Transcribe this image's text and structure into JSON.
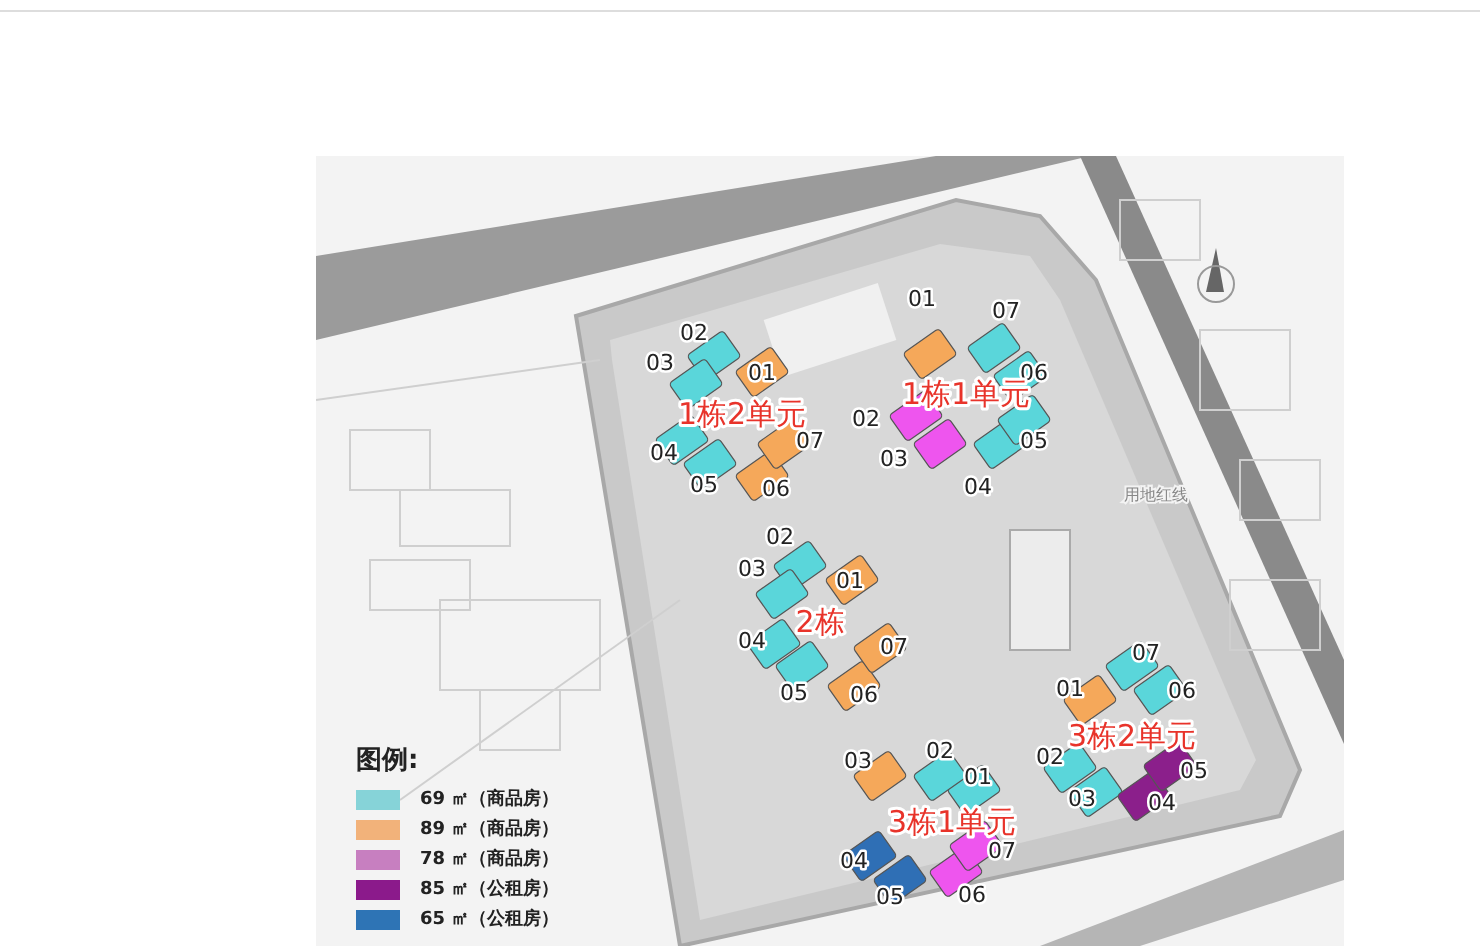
{
  "site_plan": {
    "buildings": [
      {
        "label": "1栋2单元",
        "units": [
          {
            "number": "01",
            "color": "#f5a85a"
          },
          {
            "number": "02",
            "color": "#5ad6da"
          },
          {
            "number": "03",
            "color": "#5ad6da"
          },
          {
            "number": "04",
            "color": "#5ad6da"
          },
          {
            "number": "05",
            "color": "#5ad6da"
          },
          {
            "number": "06",
            "color": "#f5a85a"
          },
          {
            "number": "07",
            "color": "#f5a85a"
          }
        ]
      },
      {
        "label": "1栋1单元",
        "units": [
          {
            "number": "01",
            "color": "#f5a85a"
          },
          {
            "number": "02",
            "color": "#ee55ee"
          },
          {
            "number": "03",
            "color": "#ee55ee"
          },
          {
            "number": "04",
            "color": "#5ad6da"
          },
          {
            "number": "05",
            "color": "#5ad6da"
          },
          {
            "number": "06",
            "color": "#5ad6da"
          },
          {
            "number": "07",
            "color": "#5ad6da"
          }
        ]
      },
      {
        "label": "2栋",
        "units": [
          {
            "number": "01",
            "color": "#f5a85a"
          },
          {
            "number": "02",
            "color": "#5ad6da"
          },
          {
            "number": "03",
            "color": "#5ad6da"
          },
          {
            "number": "04",
            "color": "#5ad6da"
          },
          {
            "number": "05",
            "color": "#5ad6da"
          },
          {
            "number": "06",
            "color": "#f5a85a"
          },
          {
            "number": "07",
            "color": "#f5a85a"
          }
        ]
      },
      {
        "label": "3栋2单元",
        "units": [
          {
            "number": "01",
            "color": "#f5a85a"
          },
          {
            "number": "02",
            "color": "#5ad6da"
          },
          {
            "number": "03",
            "color": "#5ad6da"
          },
          {
            "number": "04",
            "color": "#8b1f8b"
          },
          {
            "number": "05",
            "color": "#8b1f8b"
          },
          {
            "number": "06",
            "color": "#5ad6da"
          },
          {
            "number": "07",
            "color": "#5ad6da"
          }
        ]
      },
      {
        "label": "3栋1单元",
        "units": [
          {
            "number": "01",
            "color": "#5ad6da"
          },
          {
            "number": "02",
            "color": "#5ad6da"
          },
          {
            "number": "03",
            "color": "#f5a85a"
          },
          {
            "number": "04",
            "color": "#2f6fb5"
          },
          {
            "number": "05",
            "color": "#2f6fb5"
          },
          {
            "number": "06",
            "color": "#ee55ee"
          },
          {
            "number": "07",
            "color": "#ee55ee"
          }
        ]
      }
    ],
    "map_note": "用地红线",
    "legend": {
      "title": "图例:",
      "items": [
        {
          "text": "69 ㎡（商品房）",
          "color": "#86d3d8"
        },
        {
          "text": "89 ㎡（商品房）",
          "color": "#f2b27a"
        },
        {
          "text": "78 ㎡（商品房）",
          "color": "#c77fc0"
        },
        {
          "text": "85 ㎡（公租房）",
          "color": "#8b1a8b"
        },
        {
          "text": "65 ㎡（公租房）",
          "color": "#2e74b5"
        }
      ]
    }
  }
}
